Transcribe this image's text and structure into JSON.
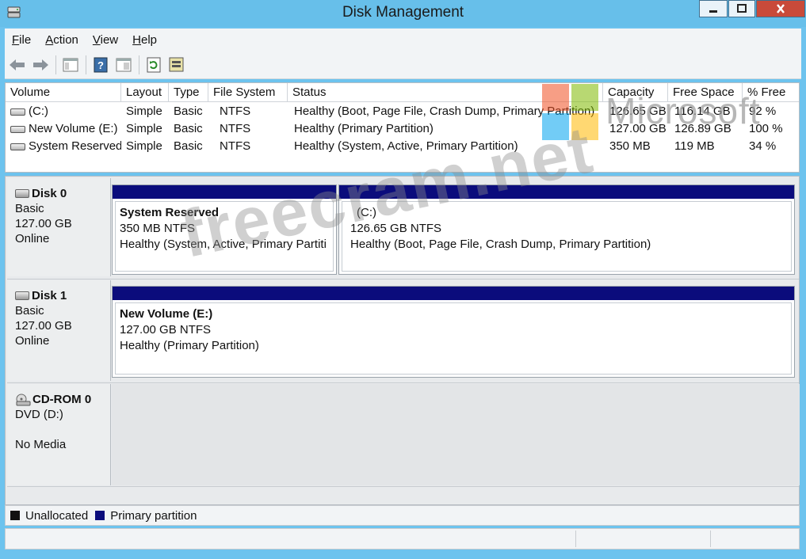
{
  "window": {
    "title": "Disk Management"
  },
  "menu": [
    {
      "label": "File",
      "u": "F",
      "rest": "ile"
    },
    {
      "label": "Action",
      "u": "A",
      "rest": "ction"
    },
    {
      "label": "View",
      "u": "V",
      "rest": "iew"
    },
    {
      "label": "Help",
      "u": "H",
      "rest": "elp"
    }
  ],
  "toolbar": [
    "back-icon",
    "forward-icon",
    "console-tree-icon",
    "help-icon",
    "properties-icon",
    "refresh-icon",
    "rescan-icon"
  ],
  "volumes": {
    "headers": [
      "Volume",
      "Layout",
      "Type",
      "File System",
      "Status",
      "Capacity",
      "Free Space",
      "% Free"
    ],
    "rows": [
      {
        "volume": "(C:)",
        "layout": "Simple",
        "type": "Basic",
        "fs": "NTFS",
        "status": "Healthy (Boot, Page File, Crash Dump, Primary Partition)",
        "capacity": "126.65 GB",
        "free": "116.14 GB",
        "pct": "92 %"
      },
      {
        "volume": "New Volume (E:)",
        "layout": "Simple",
        "type": "Basic",
        "fs": "NTFS",
        "status": "Healthy (Primary Partition)",
        "capacity": "127.00 GB",
        "free": "126.89 GB",
        "pct": "100 %"
      },
      {
        "volume": "System Reserved",
        "layout": "Simple",
        "type": "Basic",
        "fs": "NTFS",
        "status": "Healthy (System, Active, Primary Partition)",
        "capacity": "350 MB",
        "free": "119 MB",
        "pct": "34 %"
      }
    ]
  },
  "disks": [
    {
      "name": "Disk 0",
      "kind": "Basic",
      "size": "127.00 GB",
      "state": "Online",
      "partitions": [
        {
          "title": "System Reserved",
          "size": "350 MB NTFS",
          "status": "Healthy (System, Active, Primary Partiti"
        },
        {
          "title": "(C:)",
          "size": "126.65 GB NTFS",
          "status": "Healthy (Boot, Page File, Crash Dump, Primary Partition)"
        }
      ]
    },
    {
      "name": "Disk 1",
      "kind": "Basic",
      "size": "127.00 GB",
      "state": "Online",
      "partitions": [
        {
          "title": "New Volume  (E:)",
          "size": "127.00 GB NTFS",
          "status": "Healthy (Primary Partition)"
        }
      ]
    },
    {
      "name": "CD-ROM 0",
      "kind": "DVD (D:)",
      "size": "",
      "state": "No Media"
    }
  ],
  "legend": [
    {
      "label": "Unallocated",
      "color": "#111111"
    },
    {
      "label": "Primary partition",
      "color": "#0b0c7c"
    }
  ],
  "watermark": {
    "logo_text": "Microsoft",
    "site": "freecram.net"
  }
}
